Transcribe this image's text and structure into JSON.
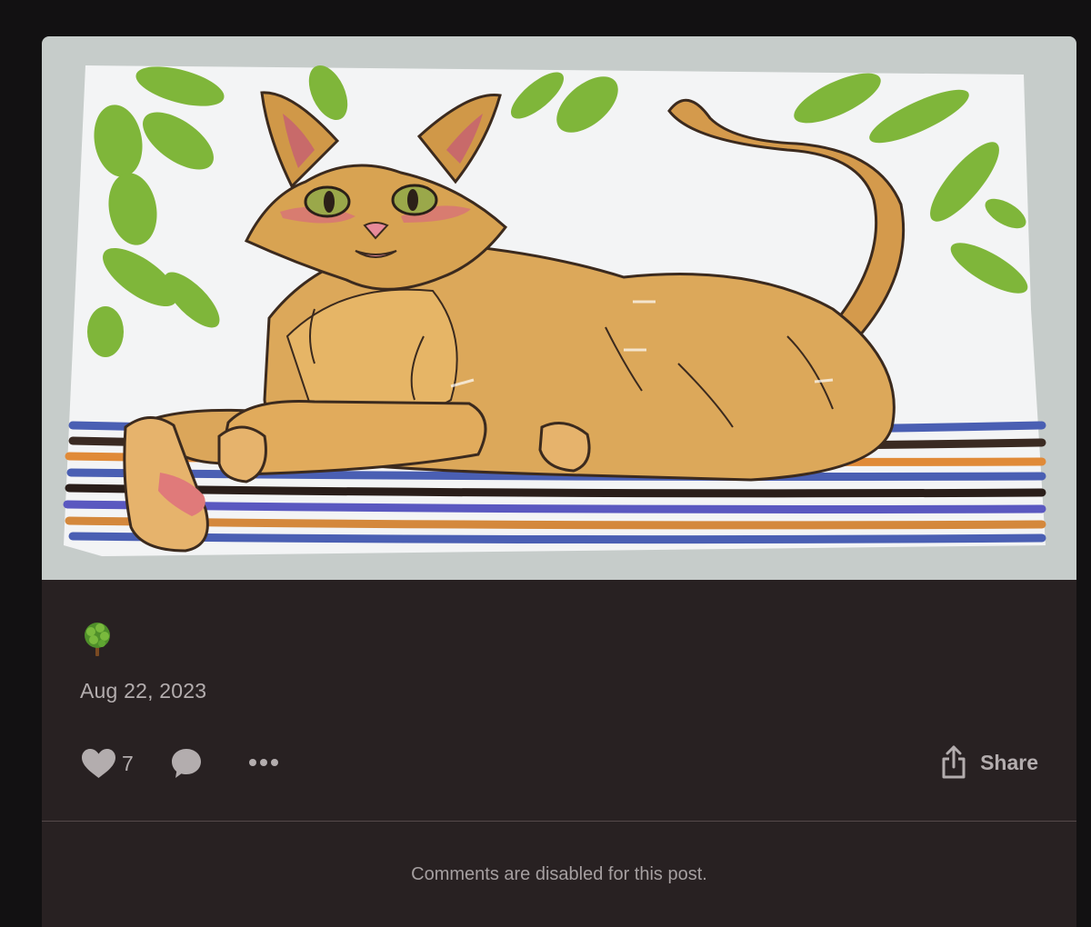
{
  "post": {
    "image": {
      "name": "cat-illustration"
    },
    "reaction_emoji": "tree-icon",
    "date": "Aug 22, 2023",
    "likes": {
      "icon": "heart-icon",
      "count": "7"
    },
    "comment": {
      "icon": "comment-bubble-icon"
    },
    "more": {
      "icon": "ellipsis-icon"
    },
    "share": {
      "icon": "share-icon",
      "label": "Share"
    },
    "comments_note": "Comments are disabled for this post."
  },
  "colors": {
    "page_background": "#121112",
    "card_background": "#282122",
    "text_muted": "#b3adae",
    "icon": "#b3adae",
    "divider": "#55494b"
  }
}
